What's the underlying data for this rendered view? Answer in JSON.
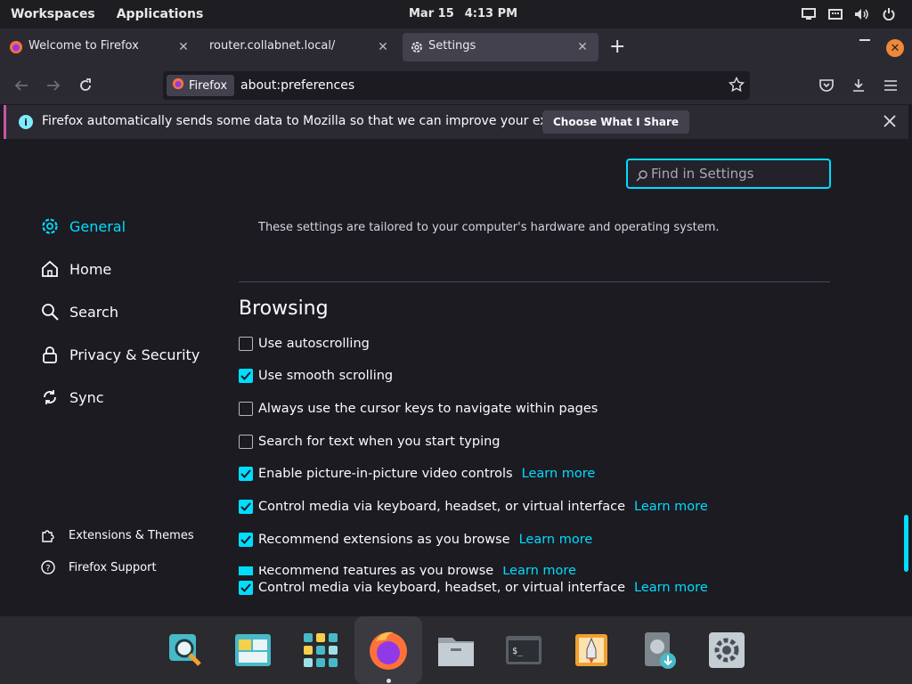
{
  "topbar": {
    "workspaces": "Workspaces",
    "applications": "Applications",
    "date": "Mar 15",
    "time": "4:13 PM"
  },
  "tabs": [
    {
      "title": "Welcome to Firefox",
      "icon": "firefox-icon"
    },
    {
      "title": "router.collabnet.local/",
      "icon": ""
    },
    {
      "title": "Settings",
      "icon": "gear-icon",
      "active": true
    }
  ],
  "urlbar": {
    "chip": "Firefox",
    "url": "about:preferences"
  },
  "notification": {
    "message": "Firefox automatically sends some data to Mozilla so that we can improve your experience.",
    "button": "Choose What I Share"
  },
  "search": {
    "placeholder": "Find in Settings"
  },
  "sidebar": {
    "items": [
      {
        "label": "General",
        "icon": "gear-icon",
        "active": true
      },
      {
        "label": "Home",
        "icon": "home-icon"
      },
      {
        "label": "Search",
        "icon": "search-icon"
      },
      {
        "label": "Privacy & Security",
        "icon": "lock-icon"
      },
      {
        "label": "Sync",
        "icon": "sync-icon"
      }
    ],
    "footer": [
      {
        "label": "Extensions & Themes",
        "icon": "puzzle-icon"
      },
      {
        "label": "Firefox Support",
        "icon": "help-icon"
      }
    ]
  },
  "main": {
    "tailored_note": "These settings are tailored to your computer's hardware and operating system.",
    "section_title": "Browsing",
    "options": [
      {
        "label": "Use autoscrolling",
        "checked": false
      },
      {
        "label": "Use smooth scrolling",
        "checked": true
      },
      {
        "label": "Always use the cursor keys to navigate within pages",
        "checked": false
      },
      {
        "label": "Search for text when you start typing",
        "checked": false
      },
      {
        "label": "Enable picture-in-picture video controls",
        "checked": true,
        "link": "Learn more"
      },
      {
        "label": "Control media via keyboard, headset, or virtual interface",
        "checked": true,
        "link": "Learn more"
      },
      {
        "label": "Recommend extensions as you browse",
        "checked": true,
        "link": "Learn more"
      },
      {
        "label": "Recommend features as you browse",
        "checked": true,
        "link": "Learn more"
      },
      {
        "label": "Control media via keyboard, headset, or virtual interface",
        "checked": true,
        "link": "Learn more"
      }
    ]
  },
  "dock": {
    "apps": [
      "magnifier-search-icon",
      "files-window-icon",
      "app-grid-icon",
      "firefox-icon",
      "file-manager-icon",
      "terminal-icon",
      "launcher-rocket-icon",
      "installer-icon",
      "settings-gear-icon"
    ],
    "terminal_prompt": "$_"
  },
  "colors": {
    "accent": "#00ddff",
    "background": "#1c1b22",
    "toolbar": "#2b2a33"
  }
}
